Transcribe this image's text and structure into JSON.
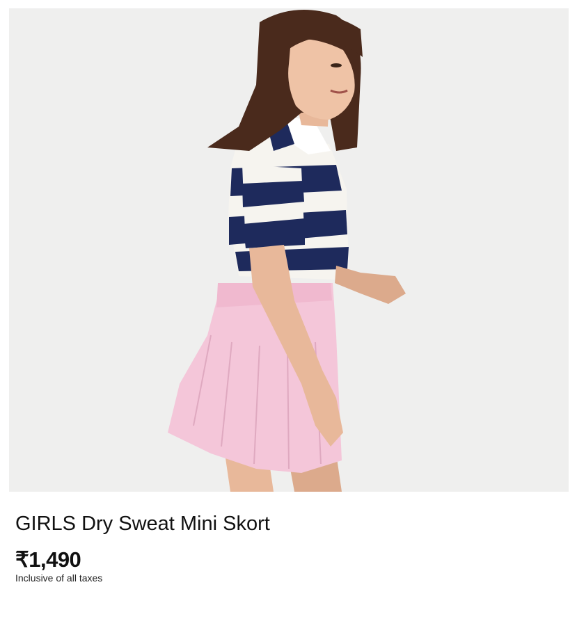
{
  "product": {
    "image_alt": "Girl wearing navy and white striped polo shirt with pink pleated mini skort",
    "title": "GIRLS Dry Sweat Mini Skort",
    "price": "₹1,490",
    "tax_note": "Inclusive of all taxes"
  },
  "colors": {
    "background": "#ffffff",
    "photo_background": "#efefee",
    "text": "#111111",
    "stripe_navy": "#1e2a5c",
    "skirt_pink": "#f4c6d9"
  }
}
